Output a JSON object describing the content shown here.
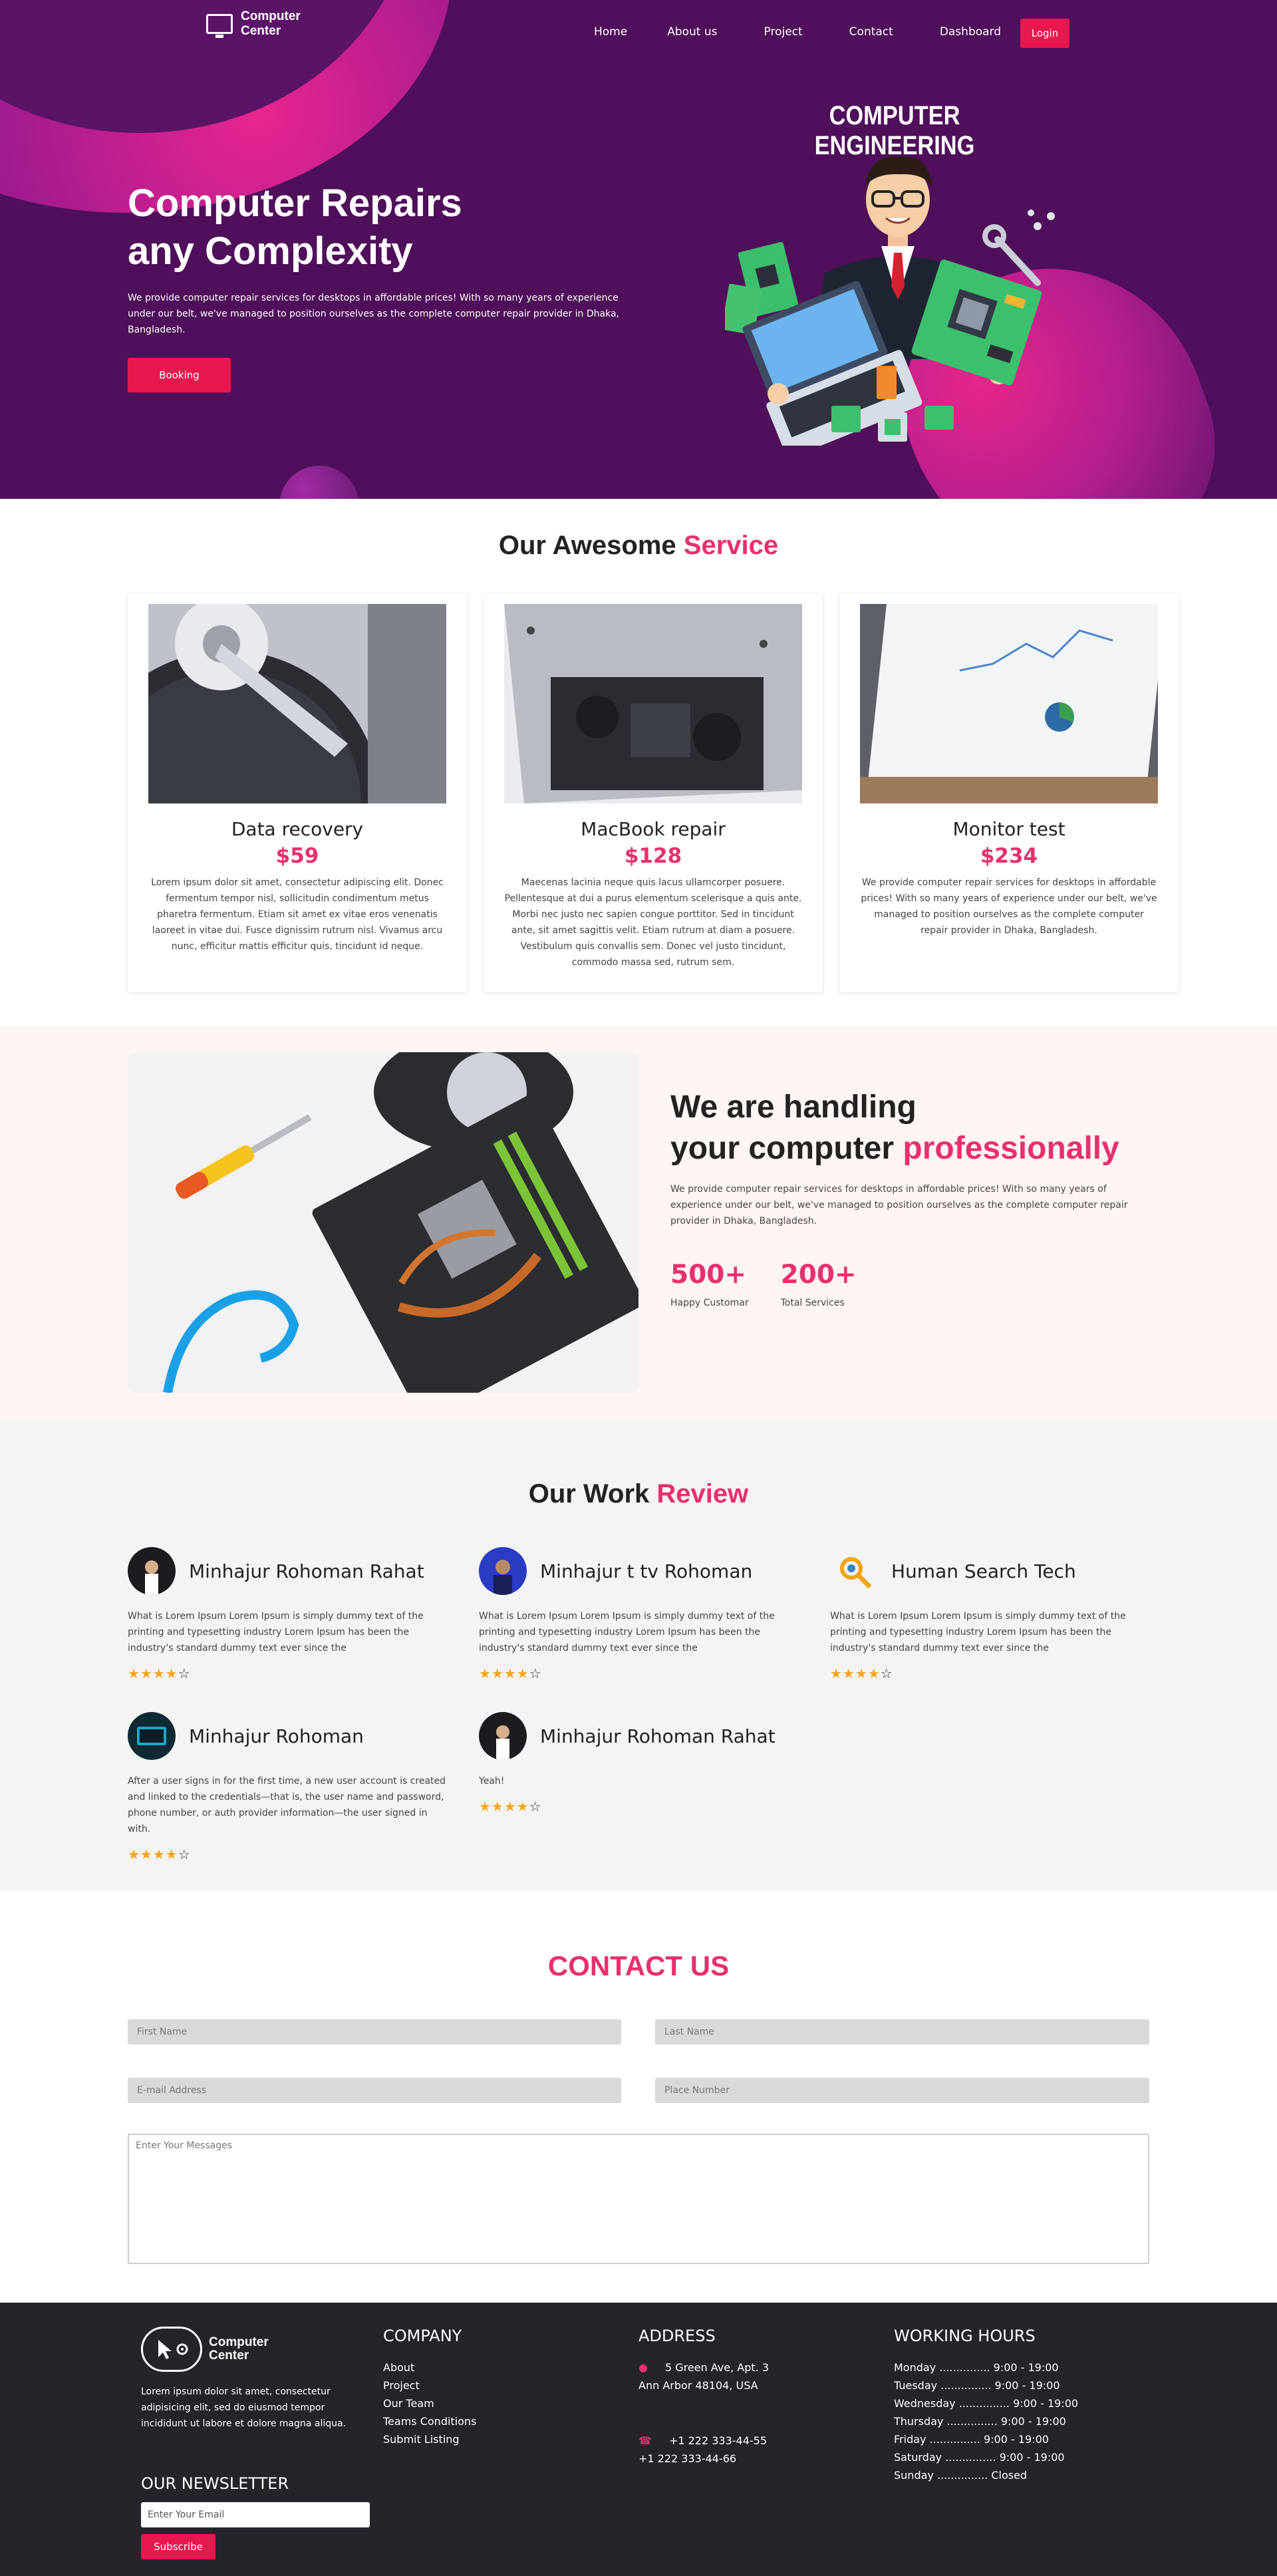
{
  "nav": {
    "logo_line1": "Computer",
    "logo_line2": "Center",
    "links": [
      "Home",
      "About us",
      "Project",
      "Contact",
      "Dashboard"
    ],
    "login": "Login"
  },
  "hero": {
    "title_line1": "Computer Repairs",
    "title_line2": "any Complexity",
    "description": "We provide computer repair services for desktops in affordable prices! With so many years of experience under our belt, we've managed to position ourselves as the complete computer repair provider in Dhaka, Bangladesh.",
    "booking": "Booking",
    "illustration_title": "COMPUTER ENGINEERING"
  },
  "services": {
    "title_plain": "Our Awesome",
    "title_accent": "Service",
    "cards": [
      {
        "name": "Data recovery",
        "price": "$59",
        "description": "Lorem ipsum dolor sit amet, consectetur adipiscing elit. Donec fermentum tempor nisl, sollicitudin condimentum metus pharetra fermentum. Etiam sit amet ex vitae eros venenatis laoreet in vitae dui. Fusce dignissim rutrum nisl. Vivamus arcu nunc, efficitur mattis efficitur quis, tincidunt id neque."
      },
      {
        "name": "MacBook repair",
        "price": "$128",
        "description": "Maecenas lacinia neque quis lacus ullamcorper posuere. Pellentesque at dui a purus elementum scelerisque a quis ante. Morbi nec justo nec sapien congue porttitor. Sed in tincidunt ante, sit amet sagittis velit. Etiam rutrum at diam a posuere. Vestibulum quis convallis sem. Donec vel justo tincidunt, commodo massa sed, rutrum sem."
      },
      {
        "name": "Monitor test",
        "price": "$234",
        "description": "We provide computer repair services for desktops in affordable prices! With so many years of experience under our belt, we've managed to position ourselves as the complete computer repair provider in Dhaka, Bangladesh."
      }
    ]
  },
  "handling": {
    "title_line1": "We are handling",
    "title_line2_plain": "your computer",
    "title_line2_accent": "professionally",
    "description": "We provide computer repair services for desktops in affordable prices! With so many years of experience under our belt, we've managed to position ourselves as the complete computer repair provider in Dhaka, Bangladesh.",
    "stats": [
      {
        "value": "500+",
        "label": "Happy Customar"
      },
      {
        "value": "200+",
        "label": "Total Services"
      }
    ]
  },
  "reviews": {
    "title_plain": "Our Work",
    "title_accent": "Review",
    "items": [
      {
        "name": "Minhajur Rohoman Rahat",
        "text": "What is Lorem Ipsum Lorem Ipsum is simply dummy text of the printing and typesetting industry Lorem Ipsum has been the industry's standard dummy text ever since the",
        "rating": 4
      },
      {
        "name": "Minhajur t tv Rohoman",
        "text": "What is Lorem Ipsum Lorem Ipsum is simply dummy text of the printing and typesetting industry Lorem Ipsum has been the industry's standard dummy text ever since the",
        "rating": 4
      },
      {
        "name": "Human Search Tech",
        "text": "What is Lorem Ipsum Lorem Ipsum is simply dummy text of the printing and typesetting industry Lorem Ipsum has been the industry's standard dummy text ever since the",
        "rating": 4
      },
      {
        "name": "Minhajur Rohoman",
        "text": "After a user signs in for the first time, a new user account is created and linked to the credentials—that is, the user name and password, phone number, or auth provider information—the user signed in with.",
        "rating": 4
      },
      {
        "name": "Minhajur Rohoman Rahat",
        "text": "Yeah!",
        "rating": 4
      }
    ]
  },
  "contact": {
    "title": "CONTACT US",
    "first_name_placeholder": "First Name",
    "last_name_placeholder": "Last Name",
    "email_placeholder": "E-mail Address",
    "phone_placeholder": "Place Number",
    "message_placeholder": "Enter Your Messages"
  },
  "footer": {
    "logo_line1": "Computer",
    "logo_line2": "Center",
    "about": "Lorem ipsum dolor sit amet, consectetur adipisicing elit, sed do eiusmod tempor incididunt ut labore et dolore magna aliqua.",
    "newsletter_title": "OUR NEWSLETTER",
    "newsletter_placeholder": "Enter Your Email",
    "subscribe": "Subscribe",
    "company_title": "COMPANY",
    "company_links": [
      "About",
      "Project",
      "Our Team",
      "Teams Conditions",
      "Submit Listing"
    ],
    "address_title": "ADDRESS",
    "address_line1": "5 Green Ave, Apt. 3",
    "address_line2": "Ann Arbor 48104, USA",
    "phone1": "+1 222 333-44-55",
    "phone2": "+1 222 333-44-66",
    "hours_title": "WORKING HOURS",
    "hours": [
      "Monday ............... 9:00 - 19:00",
      "Tuesday ............... 9:00 - 19:00",
      "Wednesday ............... 9:00 - 19:00",
      "Thursday ............... 9:00 - 19:00",
      "Friday ............... 9:00 - 19:00",
      "Saturday ............... 9:00 - 19:00",
      "Sunday ............... Closed"
    ]
  },
  "colors": {
    "accent": "#e8306e",
    "button": "#e8184f",
    "hero_bg": "#4f0f5a",
    "footer_bg": "#23252b"
  }
}
